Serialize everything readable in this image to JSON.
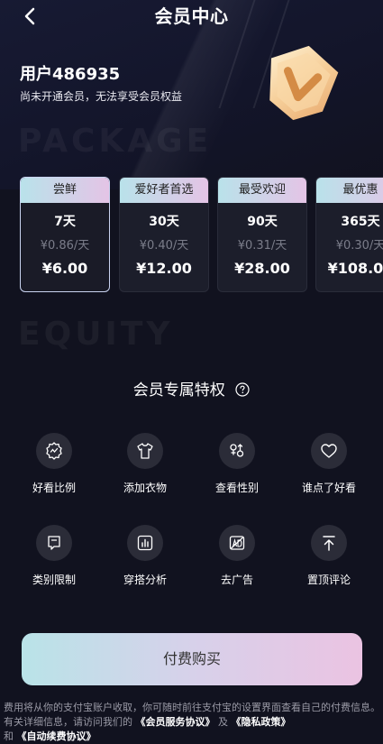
{
  "header": {
    "title": "会员中心",
    "back_icon": "chevron-left-icon"
  },
  "user": {
    "name": "用户486935",
    "status": "尚未开通会员，无法享受会员权益",
    "badge_icon": "v-badge-icon"
  },
  "section_words": {
    "package": "PACKAGE",
    "equity": "EQUITY"
  },
  "packages": [
    {
      "tag": "尝鲜",
      "days": "7天",
      "unit_price": "¥0.86/天",
      "price": "¥6.00",
      "selected": true
    },
    {
      "tag": "爱好者首选",
      "days": "30天",
      "unit_price": "¥0.40/天",
      "price": "¥12.00",
      "selected": false
    },
    {
      "tag": "最受欢迎",
      "days": "90天",
      "unit_price": "¥0.31/天",
      "price": "¥28.00",
      "selected": false
    },
    {
      "tag": "最优惠",
      "days": "365天",
      "unit_price": "¥0.30/天",
      "price": "¥108.00",
      "selected": false
    }
  ],
  "equity": {
    "title": "会员专属特权",
    "help_icon": "question-circle-icon",
    "features": [
      {
        "label": "好看比例",
        "icon": "ratio-badge-icon"
      },
      {
        "label": "添加衣物",
        "icon": "tshirt-icon"
      },
      {
        "label": "查看性别",
        "icon": "gender-icon"
      },
      {
        "label": "谁点了好看",
        "icon": "heart-icon"
      },
      {
        "label": "类别限制",
        "icon": "tag-icon"
      },
      {
        "label": "穿搭分析",
        "icon": "chart-icon"
      },
      {
        "label": "去广告",
        "icon": "no-ad-icon"
      },
      {
        "label": "置顶评论",
        "icon": "pin-top-icon"
      }
    ]
  },
  "buy_button": {
    "label": "付费购买"
  },
  "footer": {
    "text_a": "费用将从你的支付宝账户收取，你可随时前往支付宝的设置界面查看自己的付费信息。有关详细信息，请访问我们的",
    "link_service": "《会员服务协议》",
    "text_b": "及",
    "link_privacy": "《隐私政策》",
    "text_c": "和",
    "link_autorenew": "《自动续费协议》"
  },
  "colors": {
    "background": "#11121f",
    "card": "#1c1e2b",
    "accent_gradient_start": "#b9e3e8",
    "accent_gradient_end": "#ebc3e2"
  }
}
